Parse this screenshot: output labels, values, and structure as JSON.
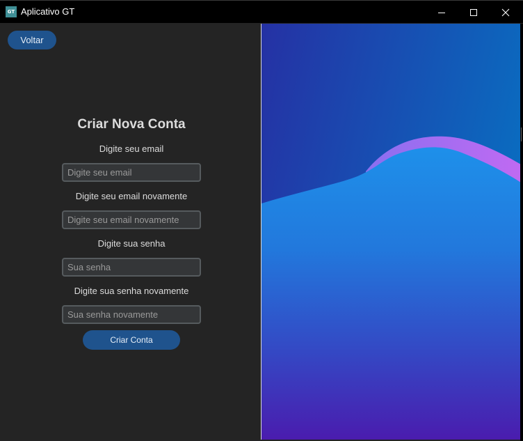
{
  "window": {
    "title": "Aplicativo GT",
    "icon_text": "GT",
    "icon_color": "#3f8f96",
    "controls": [
      "minimize-icon",
      "maximize-icon",
      "close-icon"
    ]
  },
  "nav": {
    "back_label": "Voltar"
  },
  "form": {
    "title": "Criar Nova Conta",
    "fields": [
      {
        "label": "Digite seu email",
        "placeholder": "Digite seu email"
      },
      {
        "label": "Digite seu email novamente",
        "placeholder": "Digite seu email novamente"
      },
      {
        "label": "Digite sua senha",
        "placeholder": "Sua senha"
      },
      {
        "label": "Digite sua senha novamente",
        "placeholder": "Sua senha novamente"
      }
    ],
    "submit_label": "Criar Conta"
  },
  "colors": {
    "background": "#242424",
    "button": "#1f538d",
    "input_bg": "#343638",
    "input_border": "#565b5e",
    "art_top": "#2530a0",
    "art_wave": "#1e8ee6",
    "art_wave_highlight": "#b46cf0",
    "art_bottom": "#4a1fb0"
  }
}
